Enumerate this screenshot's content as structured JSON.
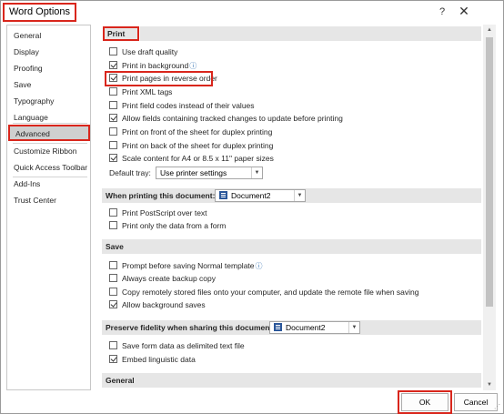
{
  "window": {
    "title": "Word Options",
    "help_label": "?",
    "close_label": "✕"
  },
  "sidebar": {
    "items": [
      {
        "label": "General"
      },
      {
        "label": "Display"
      },
      {
        "label": "Proofing"
      },
      {
        "label": "Save"
      },
      {
        "label": "Typography"
      },
      {
        "label": "Language"
      },
      {
        "label": "Advanced",
        "selected": true
      },
      {
        "label": "Customize Ribbon"
      },
      {
        "label": "Quick Access Toolbar"
      },
      {
        "label": "Add-Ins"
      },
      {
        "label": "Trust Center"
      }
    ]
  },
  "print": {
    "header": "Print",
    "options": [
      {
        "label": "Use draft quality",
        "checked": false
      },
      {
        "label": "Print in background",
        "checked": true,
        "info": true
      },
      {
        "label": "Print pages in reverse order",
        "checked": true,
        "highlighted": true
      },
      {
        "label": "Print XML tags",
        "checked": false
      },
      {
        "label": "Print field codes instead of their values",
        "checked": false
      },
      {
        "label": "Allow fields containing tracked changes to update before printing",
        "checked": true
      },
      {
        "label": "Print on front of the sheet for duplex printing",
        "checked": false
      },
      {
        "label": "Print on back of the sheet for duplex printing",
        "checked": false
      },
      {
        "label": "Scale content for A4 or 8.5 x 11\" paper sizes",
        "checked": true
      }
    ],
    "default_tray_label": "Default tray:",
    "default_tray_value": "Use printer settings"
  },
  "when_printing": {
    "header": "When printing this document:",
    "document": "Document2",
    "options": [
      {
        "label": "Print PostScript over text",
        "checked": false
      },
      {
        "label": "Print only the data from a form",
        "checked": false
      }
    ]
  },
  "save": {
    "header": "Save",
    "options": [
      {
        "label": "Prompt before saving Normal template",
        "checked": false,
        "info": true
      },
      {
        "label": "Always create backup copy",
        "checked": false
      },
      {
        "label": "Copy remotely stored files onto your computer, and update the remote file when saving",
        "checked": false
      },
      {
        "label": "Allow background saves",
        "checked": true
      }
    ]
  },
  "fidelity": {
    "header": "Preserve fidelity when sharing this document:",
    "document": "Document2",
    "options": [
      {
        "label": "Save form data as delimited text file",
        "checked": false
      },
      {
        "label": "Embed linguistic data",
        "checked": true
      }
    ]
  },
  "general": {
    "header": "General"
  },
  "footer": {
    "ok_label": "OK",
    "cancel_label": "Cancel"
  },
  "colors": {
    "highlight": "#d9261c",
    "selected_bg": "#cfcfcf",
    "section_bg": "#e6e6e6"
  }
}
